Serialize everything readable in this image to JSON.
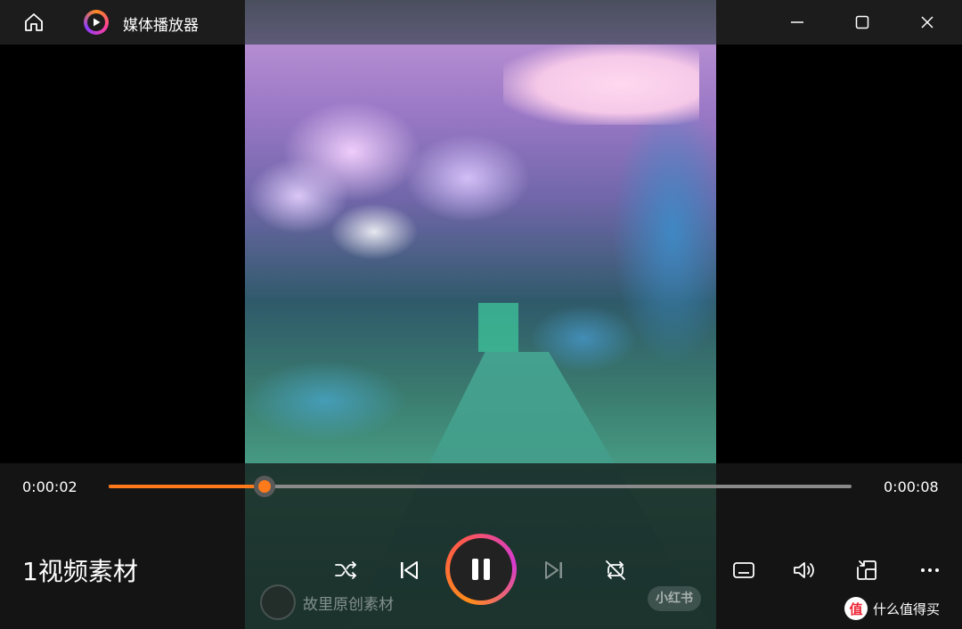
{
  "titlebar": {
    "app_title": "媒体播放器",
    "icons": {
      "home": "home-icon",
      "app": "media-player-icon",
      "minimize": "minimize-icon",
      "maximize": "maximize-icon",
      "close": "close-icon"
    }
  },
  "player": {
    "current_time": "0:00:02",
    "total_time": "0:00:08",
    "progress": 0.21,
    "media_title": "1视频素材",
    "state": "playing",
    "accent_color": "#ff7a1a"
  },
  "controls": {
    "shuffle": "shuffle-icon",
    "previous": "previous-icon",
    "play_pause": "pause-icon",
    "next": "next-icon",
    "repeat": "repeat-icon",
    "subtitles": "subtitles-icon",
    "volume": "volume-icon",
    "mini_view": "mini-view-icon",
    "more": "more-icon"
  },
  "watermark": {
    "text": "故里原创素材",
    "badge": "小红书"
  },
  "brand": {
    "logo": "值",
    "text": "什么值得买"
  }
}
